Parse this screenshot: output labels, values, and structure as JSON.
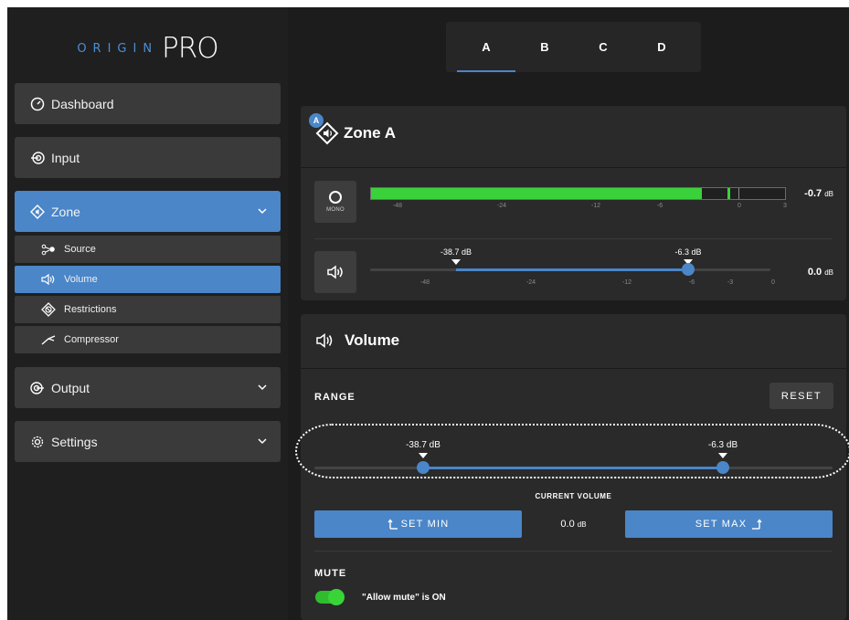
{
  "logo": {
    "word": "ORIGIN",
    "pro": "PRO"
  },
  "sidebar": {
    "items": [
      {
        "label": "Dashboard",
        "icon": "dashboard-gauge-icon"
      },
      {
        "label": "Input",
        "icon": "input-icon"
      },
      {
        "label": "Zone",
        "icon": "zone-speaker-icon",
        "expanded": true
      },
      {
        "label": "Output",
        "icon": "output-icon"
      },
      {
        "label": "Settings",
        "icon": "gear-icon"
      }
    ],
    "sub_items": [
      {
        "label": "Source",
        "icon": "source-nodes-icon"
      },
      {
        "label": "Volume",
        "icon": "speaker-volume-icon",
        "active": true
      },
      {
        "label": "Restrictions",
        "icon": "restrictions-icon"
      },
      {
        "label": "Compressor",
        "icon": "compressor-icon"
      }
    ]
  },
  "tabs": [
    {
      "label": "A",
      "active": true
    },
    {
      "label": "B"
    },
    {
      "label": "C"
    },
    {
      "label": "D"
    }
  ],
  "zone_panel": {
    "badge": "A",
    "title": "Zone A",
    "mono_label": "MONO",
    "meter": {
      "level_fraction": 0.8,
      "peak_fraction": 0.86,
      "ticks": [
        "-48",
        "-24",
        "-12",
        "-6",
        "0",
        "3"
      ],
      "readout_value": "-0.7",
      "readout_unit": "dB"
    },
    "volume_range": {
      "min_label": "-38.7 dB",
      "max_label": "-6.3 dB",
      "ticks": [
        "-48",
        "-24",
        "-12",
        "-6",
        "-3",
        "0"
      ],
      "readout_value": "0.0",
      "readout_unit": "dB"
    }
  },
  "volume_panel": {
    "title": "Volume",
    "range_label": "RANGE",
    "reset_label": "RESET",
    "min_label": "-38.7 dB",
    "max_label": "-6.3 dB",
    "current_volume_label": "CURRENT VOLUME",
    "set_min_label": "SET MIN",
    "current_value": "0.0",
    "current_unit": "dB",
    "set_max_label": "SET MAX",
    "mute_label": "MUTE",
    "allow_mute_text": "\"Allow mute\" is ON",
    "allow_mute_on": true
  },
  "colors": {
    "accent": "#4a86c8",
    "meter_green": "#3ad23a",
    "panel_bg": "#2a2a2a",
    "sidebar_bg": "#1f1f1f"
  }
}
